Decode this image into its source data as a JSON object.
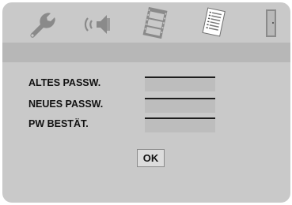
{
  "menu_icons": [
    "wrench-icon",
    "speaker-icon",
    "film-icon",
    "document-icon",
    "door-icon"
  ],
  "password_form": {
    "old_password_label": "ALTES PASSW.",
    "new_password_label": "NEUES PASSW.",
    "confirm_password_label": "PW BESTÄT.",
    "old_password_value": "",
    "new_password_value": "",
    "confirm_password_value": "",
    "ok_label": "OK"
  },
  "colors": {
    "screen_background": "#c9c9c9",
    "menu_strip": "#b7b7b7",
    "selected_icon": "#ffffff",
    "unselected_icon": "#8a8a8a",
    "text": "#111111"
  }
}
